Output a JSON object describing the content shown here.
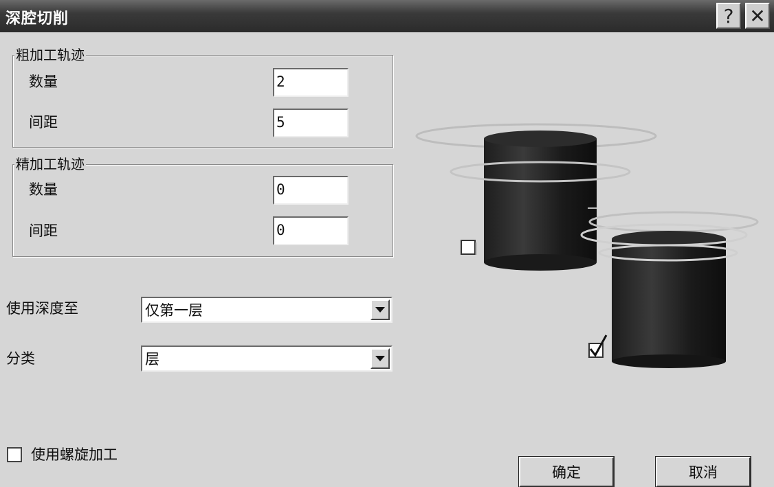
{
  "window": {
    "title": "深腔切削",
    "help_symbol": "?",
    "close_symbol": "✕"
  },
  "rough": {
    "legend": "粗加工轨迹",
    "count_label": "数量",
    "count_value": "2",
    "spacing_label": "间距",
    "spacing_value": "5"
  },
  "finish": {
    "legend": "精加工轨迹",
    "count_label": "数量",
    "count_value": "0",
    "spacing_label": "间距",
    "spacing_value": "0"
  },
  "depth": {
    "label": "使用深度至",
    "selected": "仅第一层"
  },
  "sort": {
    "label": "分类",
    "selected": "层"
  },
  "spiral": {
    "label": "使用螺旋加工",
    "checked": false
  },
  "buttons": {
    "ok": "确定",
    "cancel": "取消"
  },
  "illustration": {
    "unchecked_box_icon": "unchecked-box-icon",
    "checked_box_icon": "checked-box-icon"
  }
}
